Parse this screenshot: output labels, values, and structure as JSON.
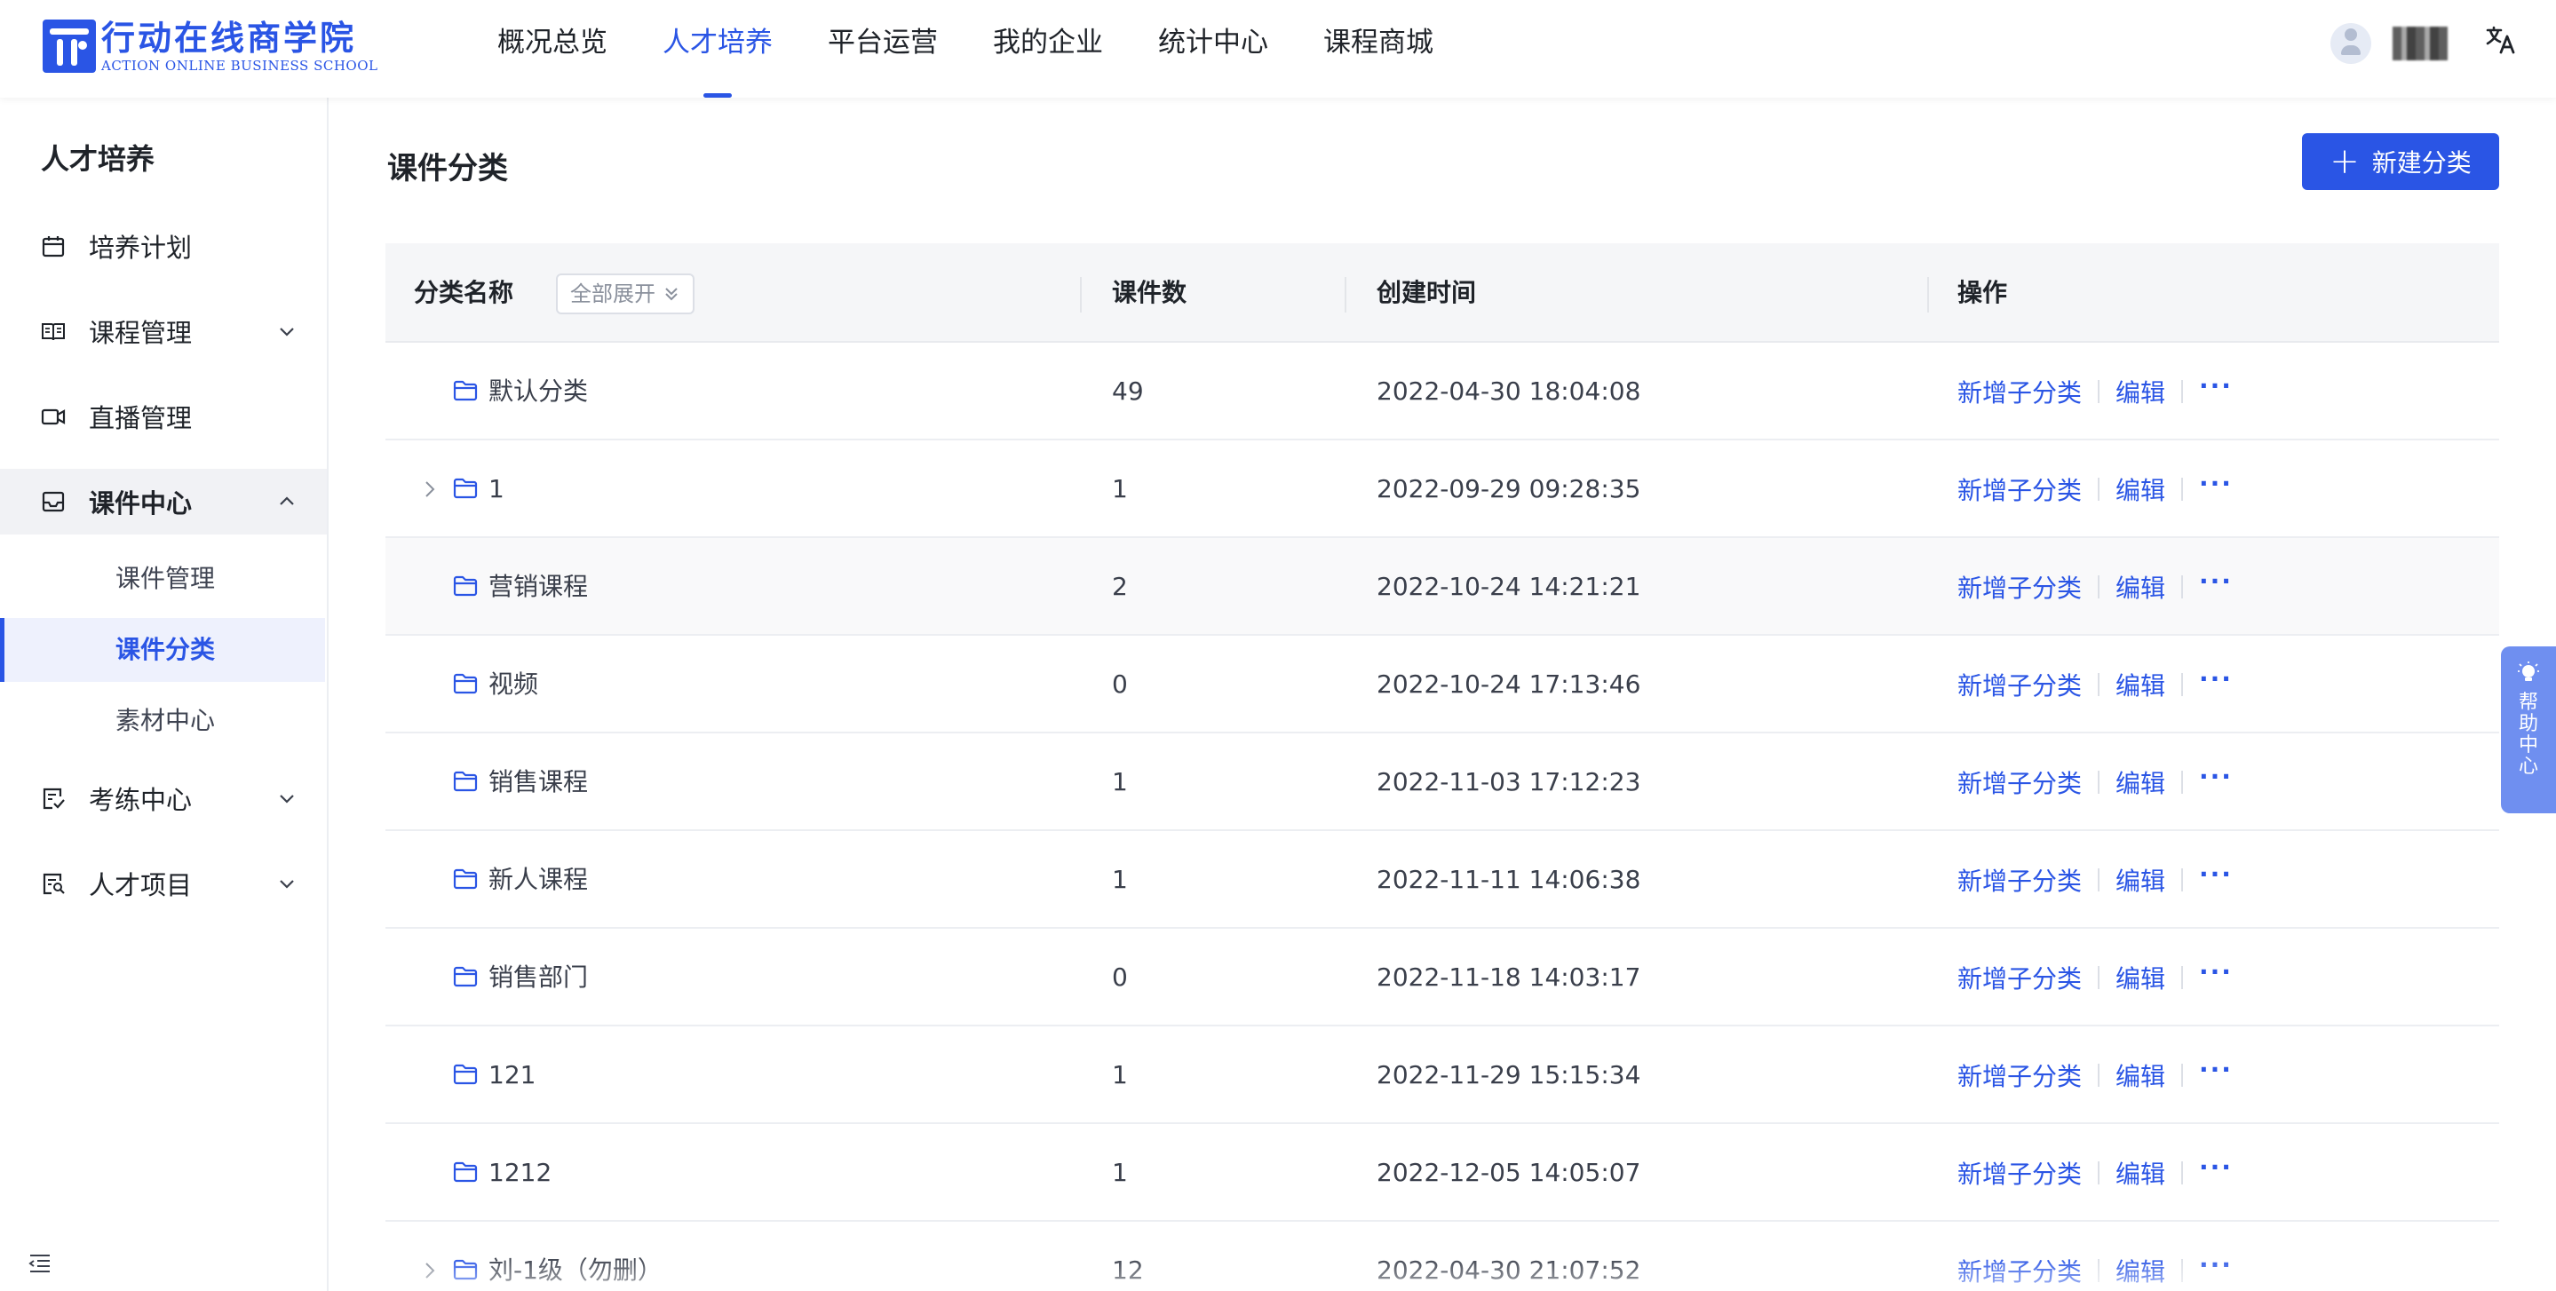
{
  "logo": {
    "cn": "行动在线商学院",
    "en": "ACTION ONLINE BUSINESS SCHOOL"
  },
  "top_nav": [
    {
      "label": "概况总览",
      "active": false
    },
    {
      "label": "人才培养",
      "active": true
    },
    {
      "label": "平台运营",
      "active": false
    },
    {
      "label": "我的企业",
      "active": false
    },
    {
      "label": "统计中心",
      "active": false
    },
    {
      "label": "课程商城",
      "active": false
    }
  ],
  "header_right": {
    "lang_icon": "文A"
  },
  "sidebar": {
    "title": "人才培养",
    "items": [
      {
        "label": "培养计划",
        "icon": "calendar-icon"
      },
      {
        "label": "课程管理",
        "icon": "book-icon"
      },
      {
        "label": "直播管理",
        "icon": "video-icon"
      },
      {
        "label": "课件中心",
        "icon": "inbox-icon"
      },
      {
        "label": "考练中心",
        "icon": "exam-icon"
      },
      {
        "label": "人才项目",
        "icon": "project-icon"
      }
    ],
    "sub_items": [
      {
        "label": "课件管理",
        "active": false
      },
      {
        "label": "课件分类",
        "active": true
      },
      {
        "label": "素材中心",
        "active": false
      }
    ]
  },
  "main": {
    "title": "课件分类",
    "new_button": "新建分类",
    "expand_all": "全部展开",
    "columns": [
      "分类名称",
      "课件数",
      "创建时间",
      "操作"
    ],
    "actions": {
      "add_sub": "新增子分类",
      "edit": "编辑",
      "more": "···"
    },
    "rows": [
      {
        "name": "默认分类",
        "count": "49",
        "time": "2022-04-30 18:04:08",
        "expandable": false
      },
      {
        "name": "1",
        "count": "1",
        "time": "2022-09-29 09:28:35",
        "expandable": true
      },
      {
        "name": "营销课程",
        "count": "2",
        "time": "2022-10-24 14:21:21",
        "expandable": false
      },
      {
        "name": "视频",
        "count": "0",
        "time": "2022-10-24 17:13:46",
        "expandable": false
      },
      {
        "name": "销售课程",
        "count": "1",
        "time": "2022-11-03 17:12:23",
        "expandable": false
      },
      {
        "name": "新人课程",
        "count": "1",
        "time": "2022-11-11 14:06:38",
        "expandable": false
      },
      {
        "name": "销售部门",
        "count": "0",
        "time": "2022-11-18 14:03:17",
        "expandable": false
      },
      {
        "name": "121",
        "count": "1",
        "time": "2022-11-29 15:15:34",
        "expandable": false
      },
      {
        "name": "1212",
        "count": "1",
        "time": "2022-12-05 14:05:07",
        "expandable": false
      },
      {
        "name": "刘-1级（勿删）",
        "count": "12",
        "time": "2022-04-30 21:07:52",
        "expandable": true
      }
    ]
  },
  "help": {
    "label": "帮助中心"
  },
  "colors": {
    "accent": "#2a55e5",
    "help_tab": "#6f8ff0"
  }
}
